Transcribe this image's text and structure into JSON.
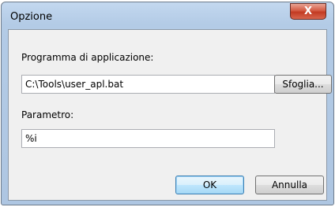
{
  "window": {
    "title": "Opzione",
    "close_glyph": "X"
  },
  "form": {
    "program_label": "Programma di applicazione:",
    "program_value": "C:\\Tools\\user_apl.bat",
    "browse_label": "Sfoglia...",
    "param_label": "Parametro:",
    "param_value": "%i"
  },
  "buttons": {
    "ok_label": "OK",
    "cancel_label": "Annulla"
  }
}
